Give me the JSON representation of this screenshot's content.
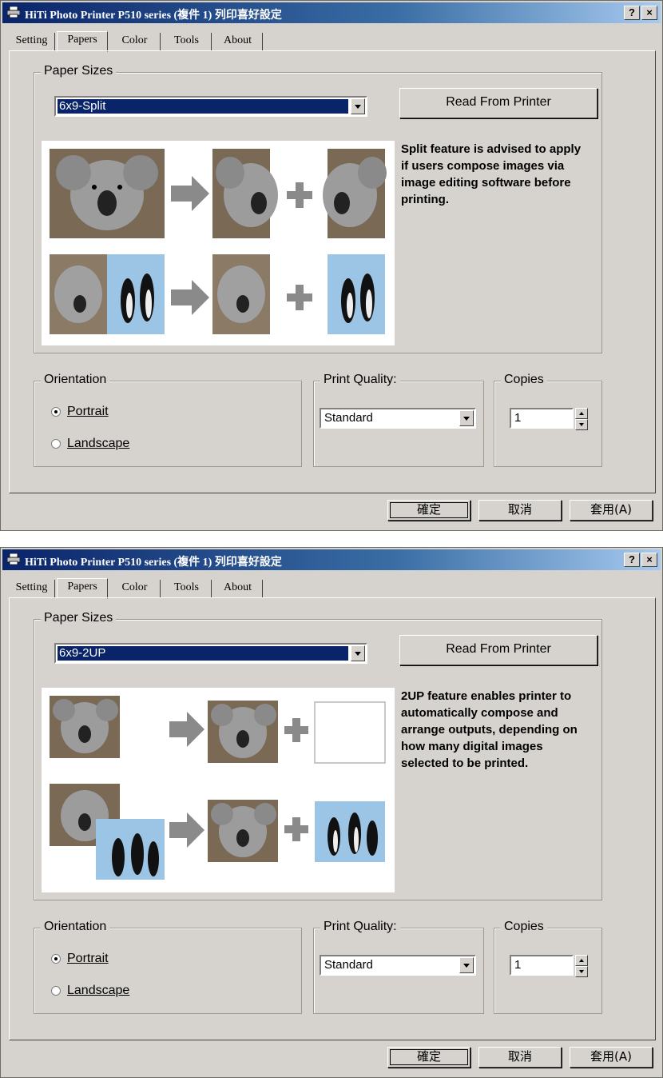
{
  "dialogs": [
    {
      "title": "HiTi Photo Printer P510 series (複件 1) 列印喜好設定",
      "help_glyph": "?",
      "close_glyph": "×",
      "tabs": [
        "Setting",
        "Papers",
        "Color",
        "Tools",
        "About"
      ],
      "active_tab": "Papers",
      "paper_sizes_label": "Paper Sizes",
      "paper_size_value": "6x9-Split",
      "read_button": "Read From Printer",
      "description": "Split feature is advised to apply if users compose images via image editing software before printing.",
      "orientation_label": "Orientation",
      "portrait_label": "Portrait",
      "landscape_label": "Landscape",
      "orientation_selected": "Portrait",
      "print_quality_label": "Print Quality:",
      "print_quality_value": "Standard",
      "copies_label": "Copies",
      "copies_value": "1",
      "ok_button": "確定",
      "cancel_button": "取消",
      "apply_button": "套用(A)"
    },
    {
      "title": "HiTi Photo Printer P510 series (複件 1) 列印喜好設定",
      "help_glyph": "?",
      "close_glyph": "×",
      "tabs": [
        "Setting",
        "Papers",
        "Color",
        "Tools",
        "About"
      ],
      "active_tab": "Papers",
      "paper_sizes_label": "Paper Sizes",
      "paper_size_value": "6x9-2UP",
      "read_button": "Read From Printer",
      "description": "2UP feature enables printer to automatically compose and arrange outputs, depending on how many digital images selected to be printed.",
      "orientation_label": "Orientation",
      "portrait_label": "Portrait",
      "landscape_label": "Landscape",
      "orientation_selected": "Portrait",
      "print_quality_label": "Print Quality:",
      "print_quality_value": "Standard",
      "copies_label": "Copies",
      "copies_value": "1",
      "ok_button": "確定",
      "cancel_button": "取消",
      "apply_button": "套用(A)"
    }
  ],
  "colors": {
    "title_bar": "#0a246a",
    "face": "#d6d3ce",
    "selection": "#0a246a",
    "arrow": "#8a8a8a"
  }
}
